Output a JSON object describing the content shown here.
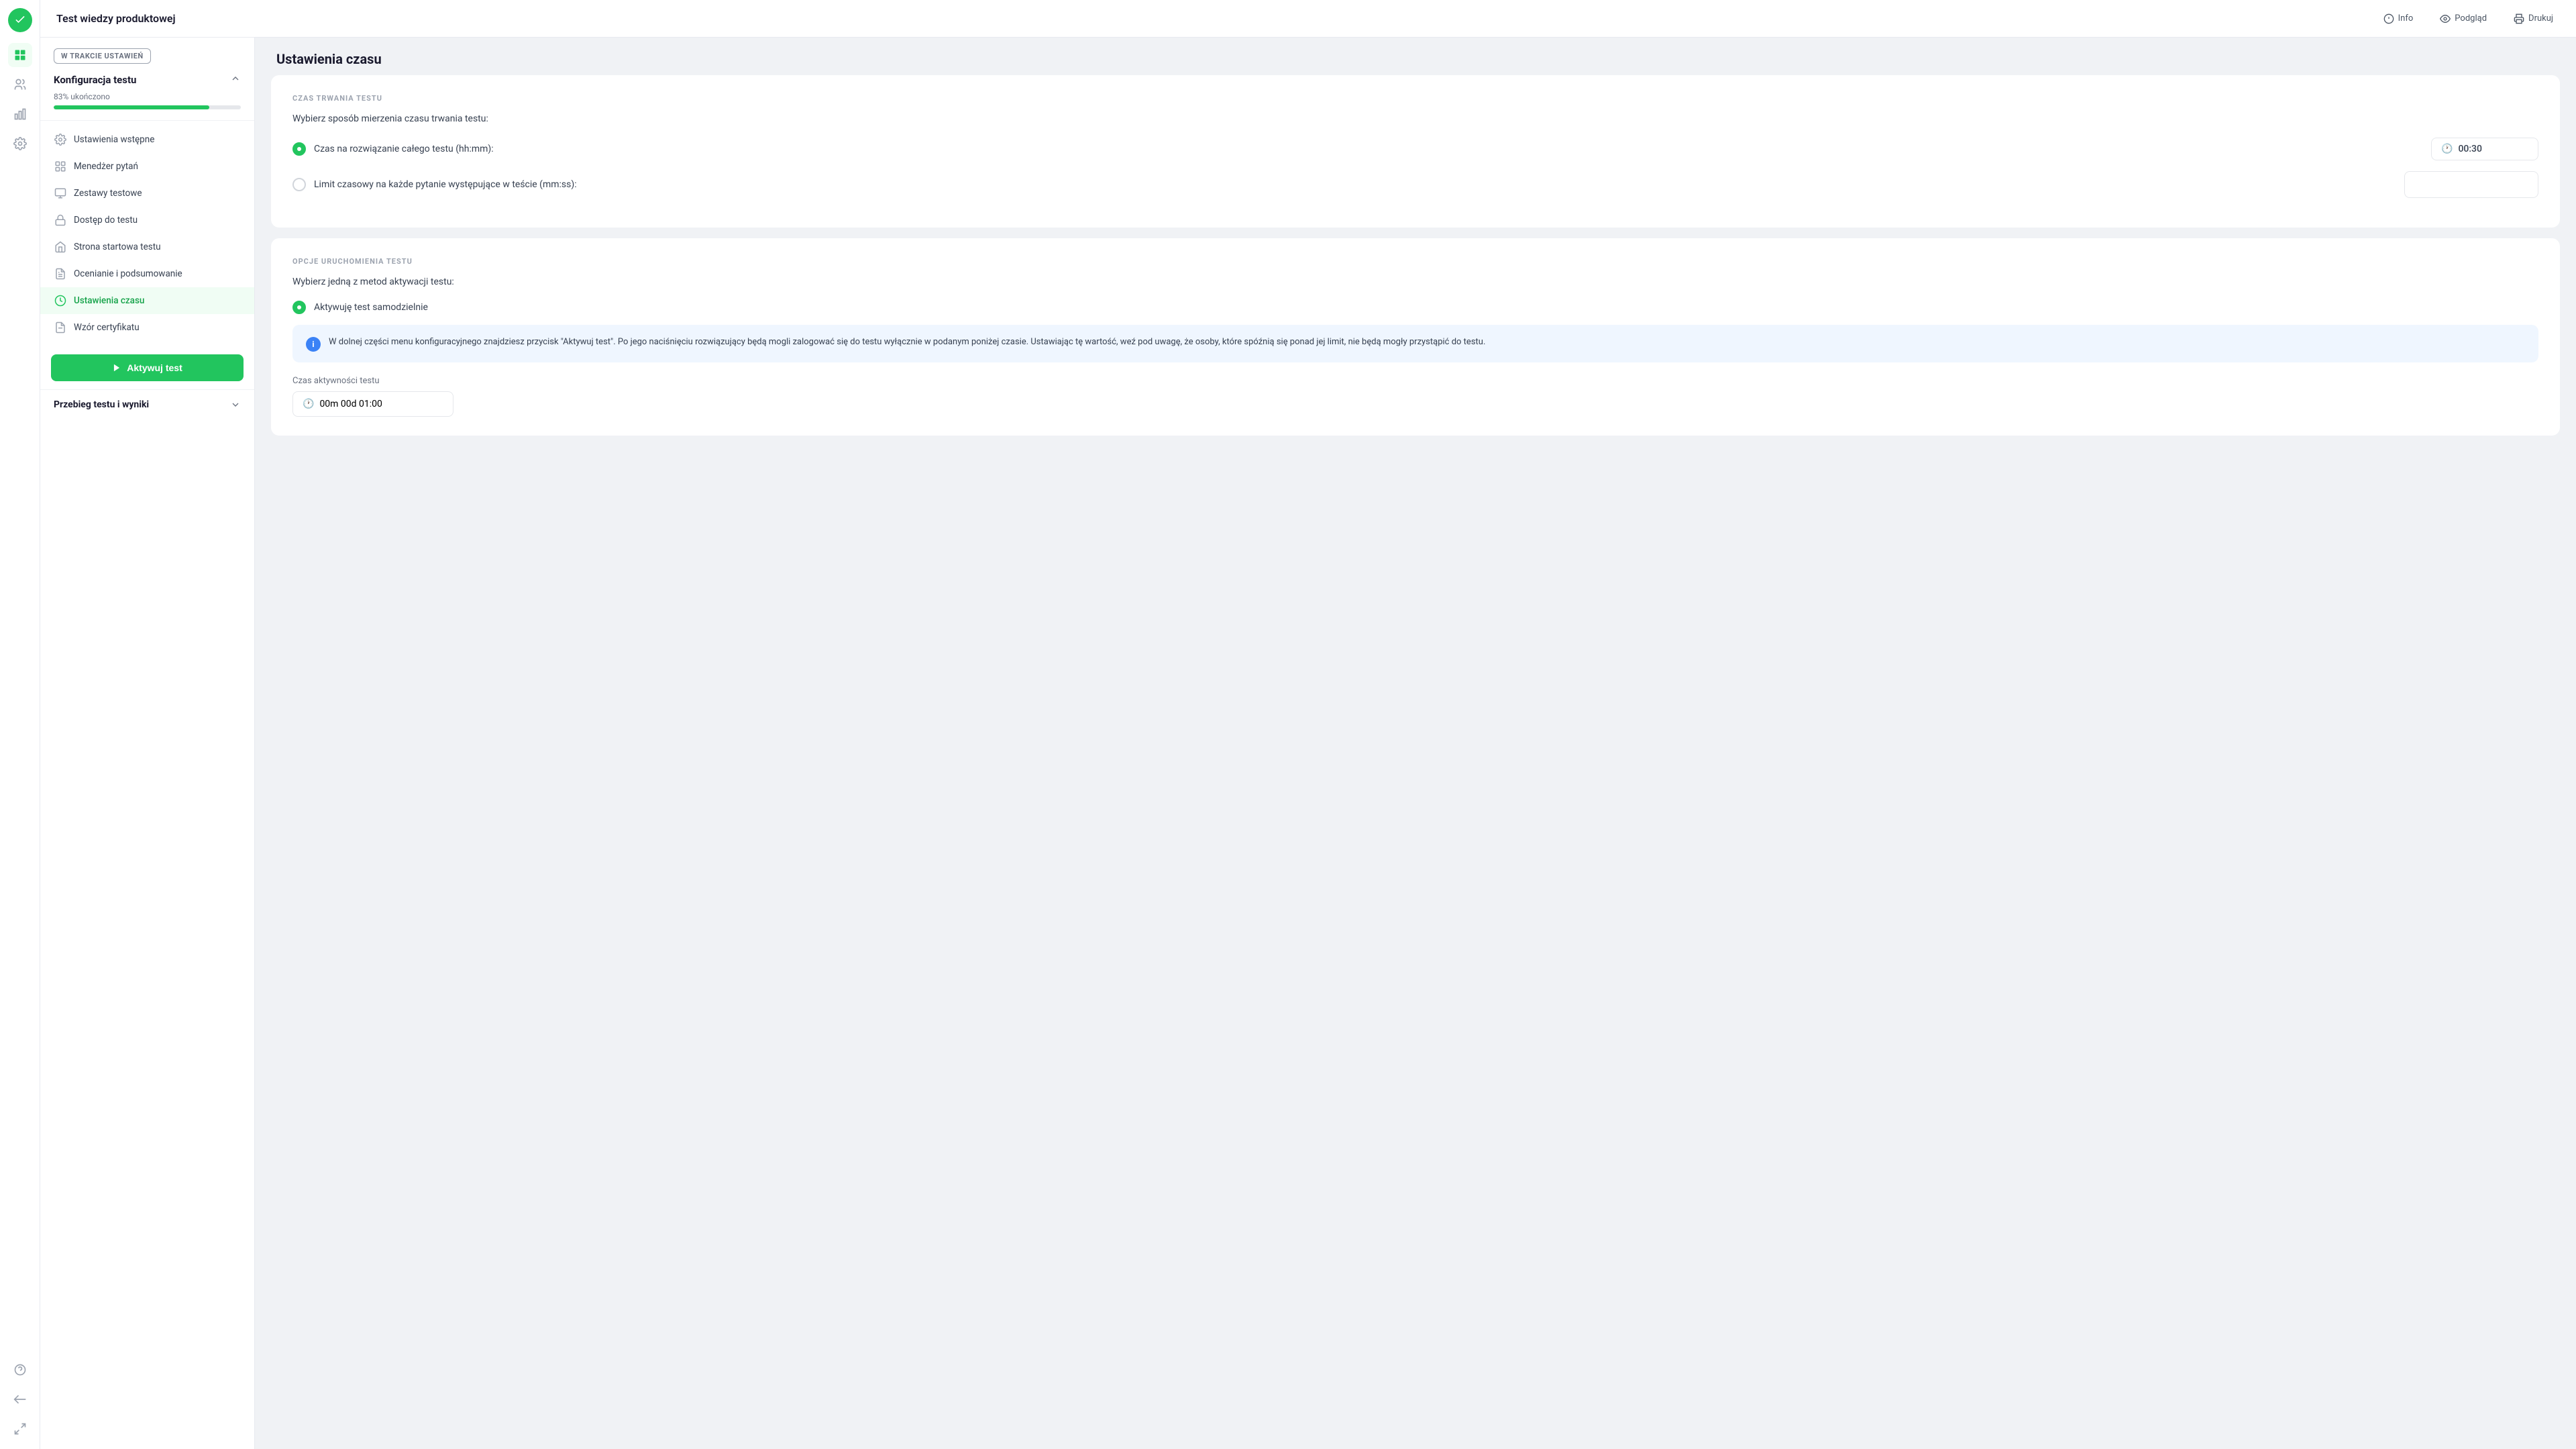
{
  "app": {
    "title": "Test wiedzy produktowej"
  },
  "header": {
    "title": "Test wiedzy produktowej",
    "actions": [
      {
        "id": "info",
        "label": "Info",
        "icon": "info-icon"
      },
      {
        "id": "podglad",
        "label": "Podgląd",
        "icon": "eye-icon"
      },
      {
        "id": "drukuj",
        "label": "Drukuj",
        "icon": "print-icon"
      }
    ]
  },
  "left_panel": {
    "status_badge": "W TRAKCIE USTAWIEŃ",
    "config_section": {
      "title": "Konfiguracja testu",
      "progress_label": "83% ukończono",
      "progress_value": 83
    },
    "nav_items": [
      {
        "id": "ustawienia-wstepne",
        "label": "Ustawienia wstępne",
        "icon": "settings-wstepne-icon",
        "active": false
      },
      {
        "id": "menedzer-pytan",
        "label": "Menedżer pytań",
        "icon": "menedzer-icon",
        "active": false
      },
      {
        "id": "zestawy-testowe",
        "label": "Zestawy testowe",
        "icon": "zestawy-icon",
        "active": false
      },
      {
        "id": "dostep-do-testu",
        "label": "Dostęp do testu",
        "icon": "dostep-icon",
        "active": false
      },
      {
        "id": "strona-startowa",
        "label": "Strona startowa testu",
        "icon": "strona-icon",
        "active": false
      },
      {
        "id": "ocenianie",
        "label": "Ocenianie i podsumowanie",
        "icon": "ocenianie-icon",
        "active": false
      },
      {
        "id": "ustawienia-czasu",
        "label": "Ustawienia czasu",
        "icon": "ustawienia-czasu-icon",
        "active": true
      },
      {
        "id": "wzor-certyfikatu",
        "label": "Wzór certyfikatu",
        "icon": "certyfikat-icon",
        "active": false
      }
    ],
    "activate_btn": "Aktywuj test",
    "wyniki_section": {
      "title": "Przebieg testu i wyniki"
    }
  },
  "main": {
    "page_title": "Ustawienia czasu",
    "czas_trwania": {
      "section_label": "CZAS TRWANIA TESTU",
      "description": "Wybierz sposób mierzenia czasu trwania testu:",
      "options": [
        {
          "id": "caly-test",
          "label": "Czas na rozwiązanie całego testu (hh:mm):",
          "selected": true,
          "time_value": "00:30"
        },
        {
          "id": "pytanie",
          "label": "Limit czasowy na każde pytanie występujące w teście (mm:ss):",
          "selected": false,
          "time_value": ""
        }
      ]
    },
    "opcje_uruchomienia": {
      "section_label": "OPCJE URUCHOMIENIA TESTU",
      "description": "Wybierz jedną z metod aktywacji testu:",
      "options": [
        {
          "id": "samodzielnie",
          "label": "Aktywuję test samodzielnie",
          "selected": true
        }
      ],
      "info_box_text": "W dolnej części menu konfiguracyjnego znajdziesz przycisk \"Aktywuj test\". Po jego naciśnięciu rozwiązujący będą mogli zalogować się do testu wyłącznie w podanym poniżej czasie. Ustawiając tę wartość, weź pod uwagę, że osoby, które spóźnią się ponad jej limit, nie będą mogły przystąpić do testu."
    },
    "czas_aktywnosci": {
      "label": "Czas aktywności testu",
      "value": "00m 00d 01:00"
    }
  },
  "sidebar_icons": [
    {
      "id": "question-mark",
      "icon": "question-icon"
    },
    {
      "id": "back-arrow",
      "icon": "back-icon"
    },
    {
      "id": "expand",
      "icon": "expand-icon"
    }
  ]
}
